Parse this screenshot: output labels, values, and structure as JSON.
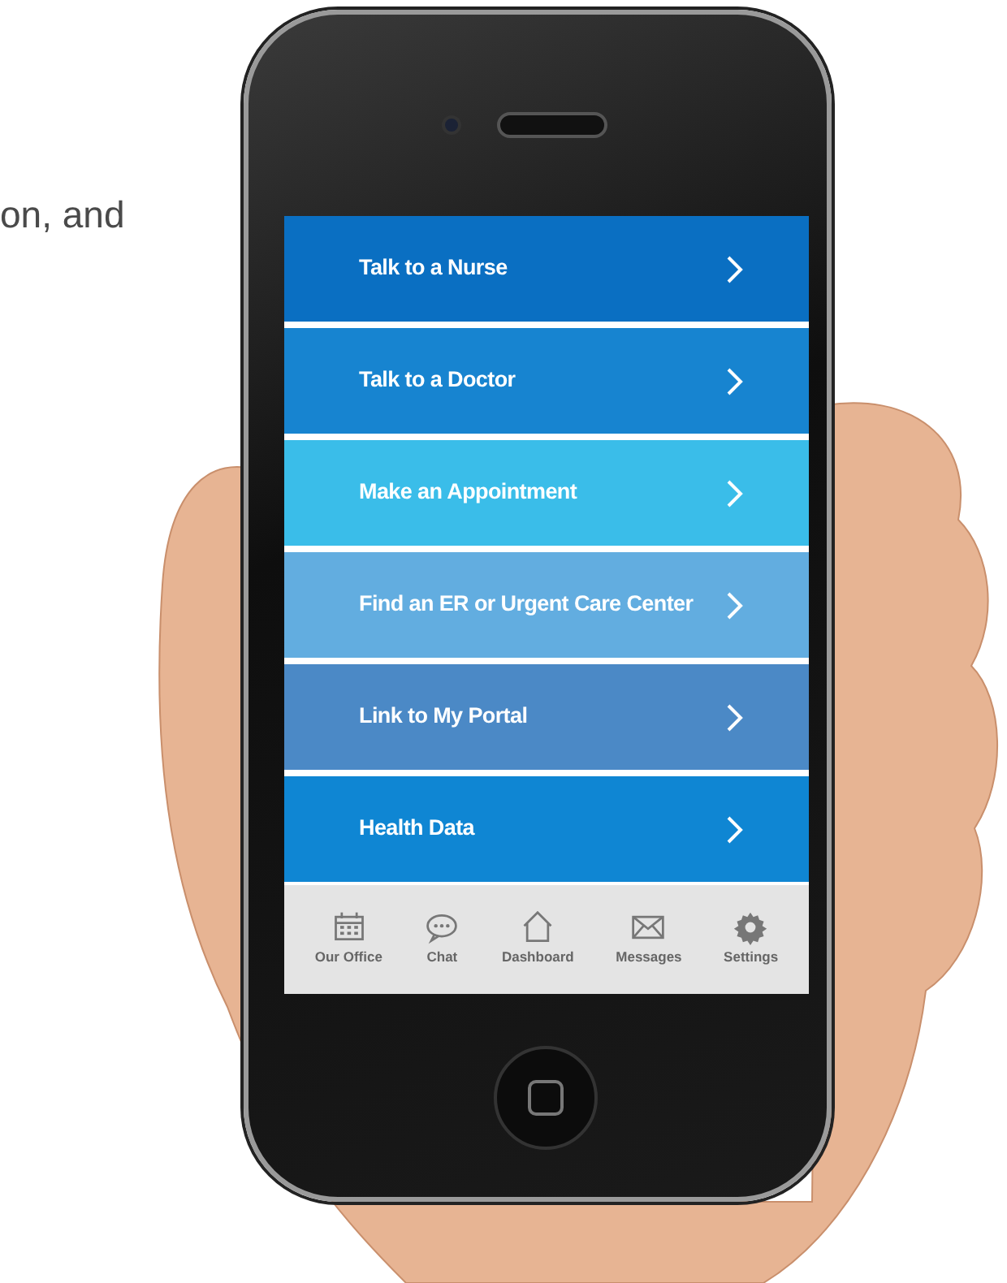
{
  "caption_fragment": "on, and",
  "menu": [
    {
      "label": "Talk to a Nurse",
      "color": "#0a6fc2"
    },
    {
      "label": "Talk to a Doctor",
      "color": "#1784d0"
    },
    {
      "label": "Make an Appointment",
      "color": "#3abde9"
    },
    {
      "label": "Find an ER or Urgent Care Center",
      "color": "#62ade0"
    },
    {
      "label": "Link to My Portal",
      "color": "#4b89c6"
    },
    {
      "label": "Health Data",
      "color": "#0f86d3"
    }
  ],
  "tab_bar": [
    {
      "label": "Our Office",
      "kind": "calendar"
    },
    {
      "label": "Chat",
      "kind": "chat"
    },
    {
      "label": "Dashboard",
      "kind": "house"
    },
    {
      "label": "Messages",
      "kind": "envelope"
    },
    {
      "label": "Settings",
      "kind": "gear"
    }
  ]
}
